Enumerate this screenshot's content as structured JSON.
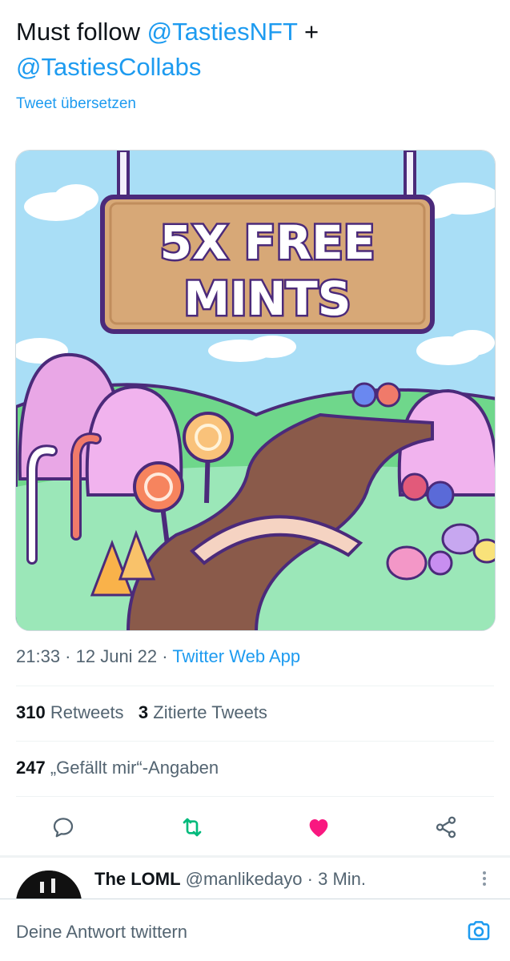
{
  "tweet": {
    "text_prefix": "Must follow ",
    "mention1": "@TastiesNFT",
    "text_joiner": " +",
    "mention2": "@TastiesCollabs",
    "translate": "Tweet übersetzen"
  },
  "media": {
    "sign_line1": "5X FREE",
    "sign_line2": "MINTS"
  },
  "meta": {
    "time": "21:33",
    "sep1": " · ",
    "date": "12 Juni 22",
    "sep2": " · ",
    "app": "Twitter Web App"
  },
  "stats": {
    "retweets_count": "310",
    "retweets_label": "Retweets",
    "quotes_count": "3",
    "quotes_label": "Zitierte Tweets",
    "likes_count": "247",
    "likes_label": "„Gefällt mir“-Angaben"
  },
  "actions": {
    "icons": [
      "reply-icon",
      "retweet-icon",
      "like-icon",
      "share-icon"
    ],
    "retweet_color": "#00ba7c",
    "like_color": "#f91880"
  },
  "reply": {
    "name": "The LOML",
    "handle": "@manlikedayo",
    "separator": " · ",
    "time": "3 Min."
  },
  "compose": {
    "placeholder": "Deine Antwort twittern"
  },
  "colors": {
    "accent": "#1d9bf0",
    "text": "#0f1419",
    "secondary": "#536471"
  }
}
